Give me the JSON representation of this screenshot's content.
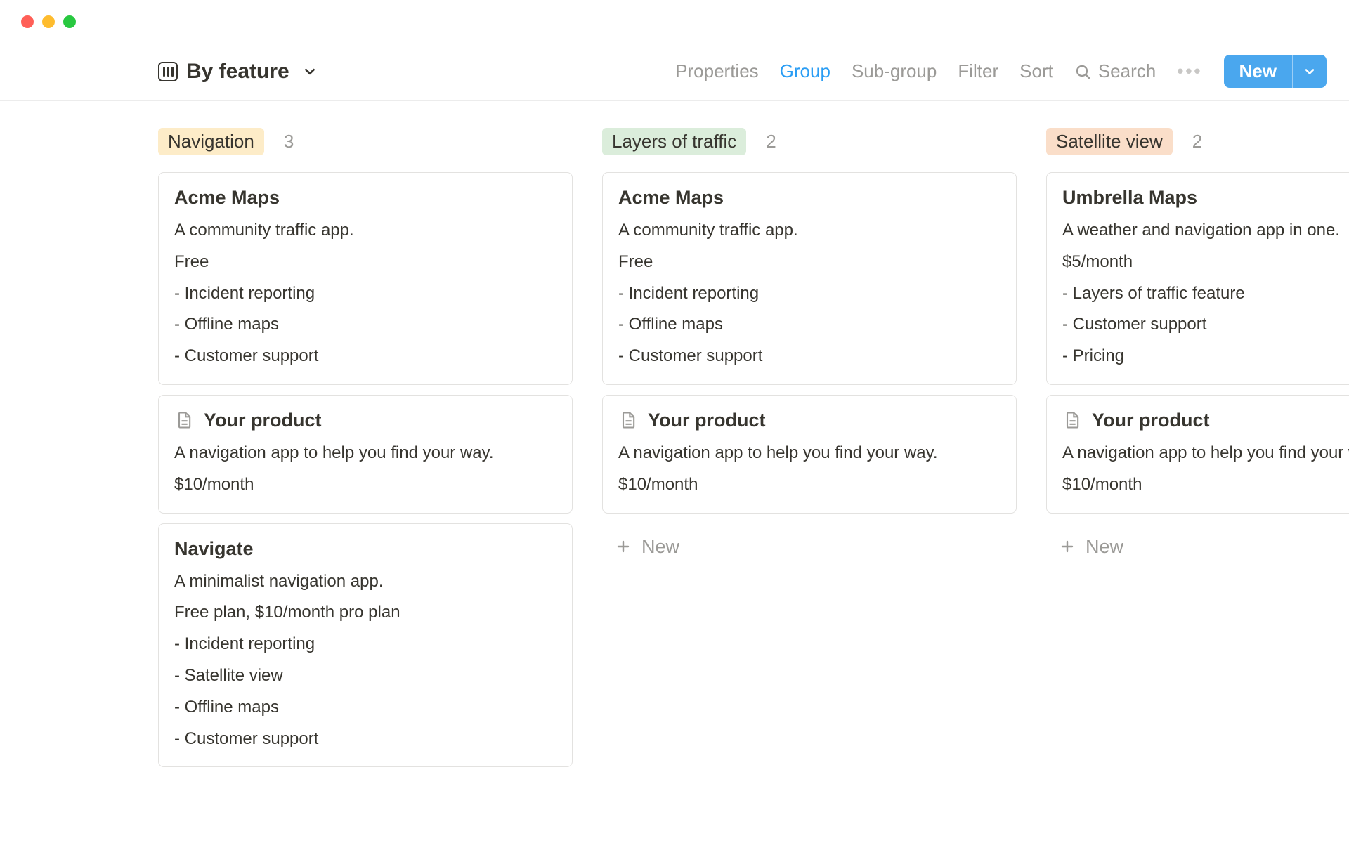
{
  "toolbar": {
    "view_label": "By feature",
    "items": {
      "properties": "Properties",
      "group": "Group",
      "subgroup": "Sub-group",
      "filter": "Filter",
      "sort": "Sort",
      "search": "Search"
    },
    "new_label": "New"
  },
  "columns": [
    {
      "tag": "Navigation",
      "tag_color": "yellow",
      "count": "3",
      "cards": [
        {
          "title": "Acme Maps",
          "desc": "A community traffic app.",
          "price": "Free",
          "features": [
            "- Incident reporting",
            "- Offline maps",
            "- Customer support"
          ],
          "has_icon": false
        },
        {
          "title": "Your product",
          "desc": "A navigation app to help you find your way.",
          "price": "$10/month",
          "features": [],
          "has_icon": true
        },
        {
          "title": "Navigate",
          "desc": "A minimalist navigation app.",
          "price": "Free plan, $10/month pro plan",
          "features": [
            "- Incident reporting",
            "- Satellite view",
            "- Offline maps",
            "- Customer support"
          ],
          "has_icon": false
        }
      ],
      "show_add_new": false
    },
    {
      "tag": "Layers of traffic",
      "tag_color": "green",
      "count": "2",
      "cards": [
        {
          "title": "Acme Maps",
          "desc": "A community traffic app.",
          "price": "Free",
          "features": [
            "- Incident reporting",
            "- Offline maps",
            "- Customer support"
          ],
          "has_icon": false
        },
        {
          "title": "Your product",
          "desc": "A navigation app to help you find your way.",
          "price": "$10/month",
          "features": [],
          "has_icon": true
        }
      ],
      "show_add_new": true
    },
    {
      "tag": "Satellite view",
      "tag_color": "orange",
      "count": "2",
      "cards": [
        {
          "title": "Umbrella Maps",
          "desc": "A weather and navigation app in one.",
          "price": "$5/month",
          "features": [
            "- Layers of traffic feature",
            "- Customer support",
            "- Pricing"
          ],
          "has_icon": false
        },
        {
          "title": "Your product",
          "desc": "A navigation app to help you find your way.",
          "price": "$10/month",
          "features": [],
          "has_icon": true
        }
      ],
      "show_add_new": true
    }
  ],
  "add_new_label": "New"
}
